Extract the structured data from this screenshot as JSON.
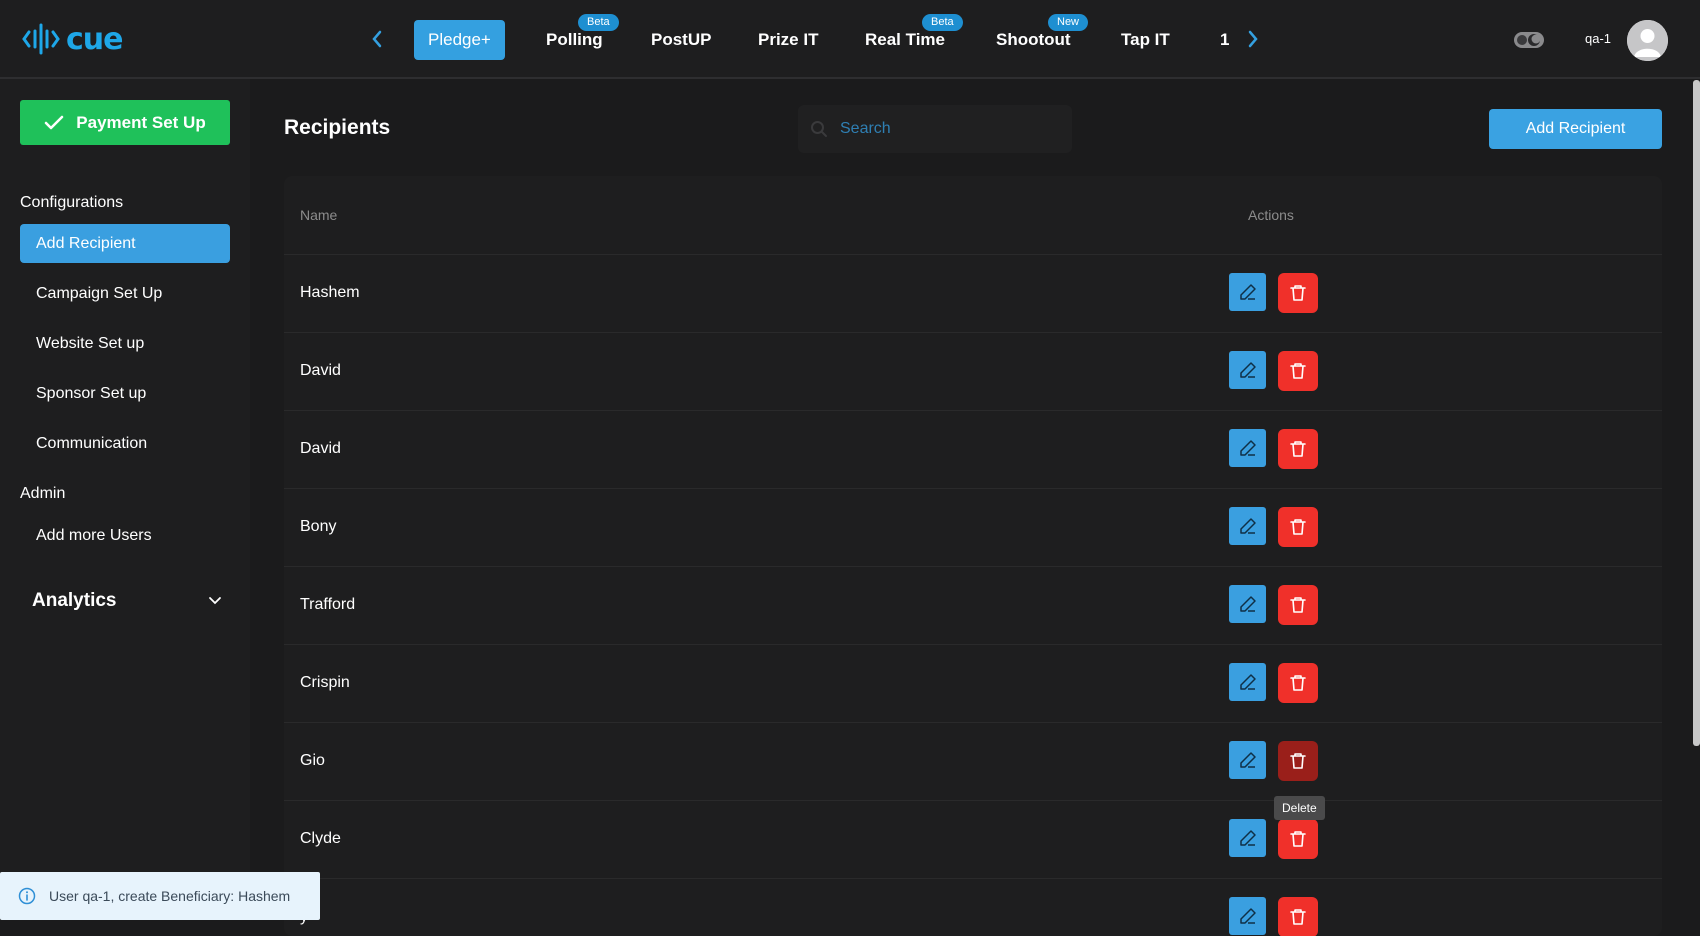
{
  "header": {
    "logo_text": "cue",
    "tabs": [
      {
        "label": "Pledge+",
        "badge": "",
        "active": true
      },
      {
        "label": "Polling",
        "badge": "Beta",
        "active": false
      },
      {
        "label": "PostUP",
        "badge": "",
        "active": false
      },
      {
        "label": "Prize IT",
        "badge": "",
        "active": false
      },
      {
        "label": "Real Time",
        "badge": "Beta",
        "active": false
      },
      {
        "label": "Shootout",
        "badge": "New",
        "active": false
      },
      {
        "label": "Tap IT",
        "badge": "",
        "active": false
      },
      {
        "label": "1",
        "badge": "",
        "active": false
      }
    ],
    "user_name": "qa-1"
  },
  "sidebar": {
    "payment_button": "Payment Set Up",
    "configurations_title": "Configurations",
    "configurations_items": [
      {
        "label": "Add Recipient",
        "active": true
      },
      {
        "label": "Campaign Set Up",
        "active": false
      },
      {
        "label": "Website Set up",
        "active": false
      },
      {
        "label": "Sponsor Set up",
        "active": false
      },
      {
        "label": "Communication",
        "active": false
      }
    ],
    "admin_title": "Admin",
    "admin_items": [
      {
        "label": "Add more Users"
      }
    ],
    "analytics_label": "Analytics"
  },
  "main": {
    "title": "Recipients",
    "search_placeholder": "Search",
    "add_button": "Add Recipient",
    "table": {
      "columns": [
        "Name",
        "Actions"
      ],
      "rows": [
        {
          "name": "Hashem"
        },
        {
          "name": "David"
        },
        {
          "name": "David"
        },
        {
          "name": "Bony"
        },
        {
          "name": "Trafford"
        },
        {
          "name": "Crispin"
        },
        {
          "name": "Gio"
        },
        {
          "name": "Clyde"
        },
        {
          "name": "y"
        }
      ]
    },
    "tooltip": "Delete"
  },
  "toast": {
    "message": "User qa-1, create Beneficiary: Hashem"
  },
  "colors": {
    "accent": "#34a0e0",
    "success": "#1fc15a",
    "danger": "#f0302a",
    "background": "#1b1b1c"
  }
}
